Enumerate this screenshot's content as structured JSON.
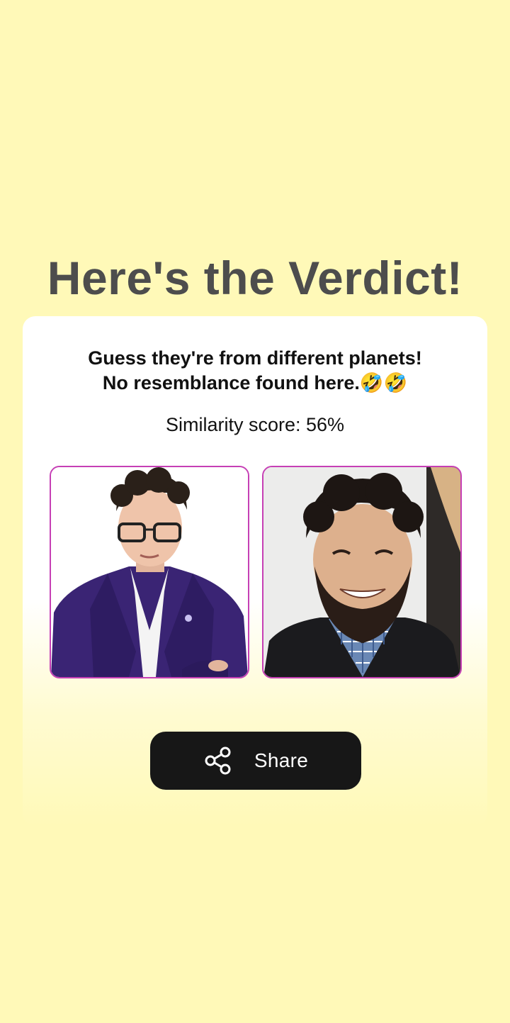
{
  "page": {
    "title": "Here's the Verdict!"
  },
  "result": {
    "verdict_line1": "Guess they're from different planets!",
    "verdict_line2": "No resemblance found here.🤣🤣",
    "score_text": "Similarity score: 56%",
    "score_value": 56
  },
  "share": {
    "label": "Share",
    "icon": "share-icon"
  },
  "colors": {
    "background": "#fff9b8",
    "title": "#4d4d4d",
    "photo_border": "#c63fb5",
    "button": "#171717"
  }
}
